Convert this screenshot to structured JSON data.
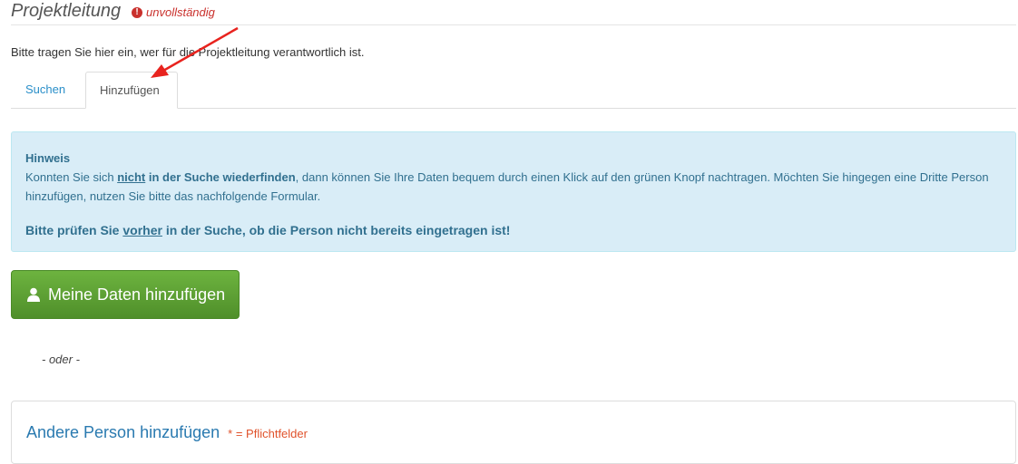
{
  "header": {
    "title": "Projektleitung",
    "status_text": "unvollständig",
    "status_icon": "exclamation-circle-icon"
  },
  "intro": "Bitte tragen Sie hier ein, wer für die Projektleitung verantwortlich ist.",
  "tabs": [
    {
      "label": "Suchen",
      "active": false
    },
    {
      "label": "Hinzufügen",
      "active": true
    }
  ],
  "alert": {
    "heading": "Hinweis",
    "line1_pre": "Konnten Sie sich ",
    "line1_emph_underline": "nicht",
    "line1_emph_rest": " in der Suche wiederfinden",
    "line1_post": ", dann können Sie Ihre Daten bequem durch einen Klick auf den grünen Knopf nachtragen. Möchten Sie hingegen eine Dritte Person hinzufügen, nutzen Sie bitte das nachfolgende Formular.",
    "check_pre": "Bitte prüfen Sie ",
    "check_underline": "vorher",
    "check_post": " in der Suche, ob die Person nicht bereits eingetragen ist!"
  },
  "add_button": {
    "label": "Meine Daten hinzufügen",
    "icon": "user-icon"
  },
  "or_text": "- oder -",
  "panel": {
    "title": "Andere Person hinzufügen",
    "required_note": "* = Pflichtfelder"
  },
  "colors": {
    "accent": "#2a8fc9",
    "alert_bg": "#d9edf7",
    "alert_text": "#31708f",
    "button_green": "#5ca334",
    "status_red": "#c9302c",
    "annotation_arrow": "#e8231e"
  }
}
